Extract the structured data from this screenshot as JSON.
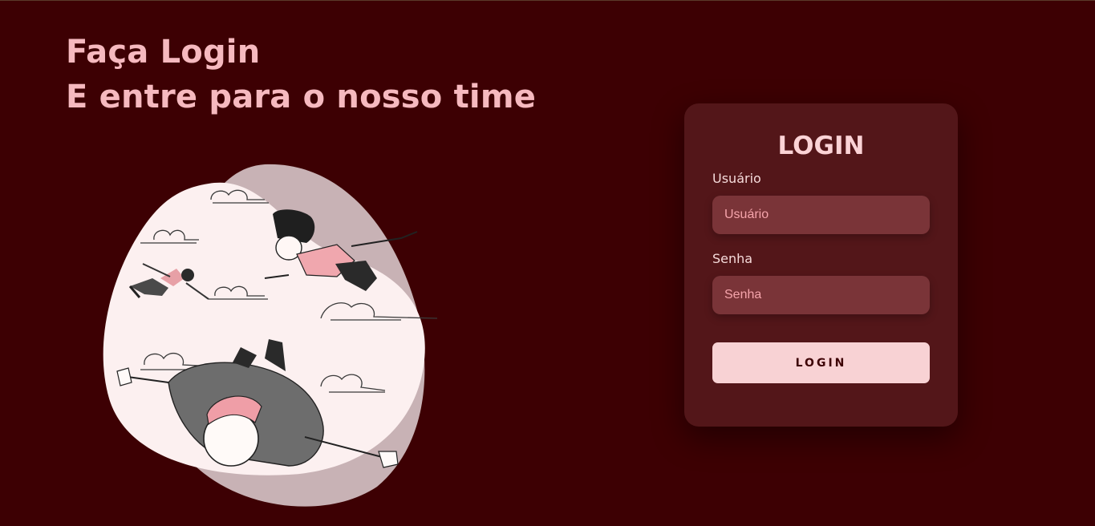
{
  "hero": {
    "title_line1": "Faça Login",
    "title_line2": "E entre para o nosso time",
    "illustration_icon": "people-skydiving-illustration"
  },
  "login_card": {
    "title": "LOGIN",
    "username": {
      "label": "Usuário",
      "value": "",
      "placeholder": "Usuário"
    },
    "password": {
      "label": "Senha",
      "value": "",
      "placeholder": "Senha"
    },
    "submit_label": "LOGIN"
  },
  "colors": {
    "background": "#3d0003",
    "accent_text": "#f6b9bf",
    "card": "#531619",
    "input": "#7a3438",
    "button": "#f8d2d4"
  }
}
